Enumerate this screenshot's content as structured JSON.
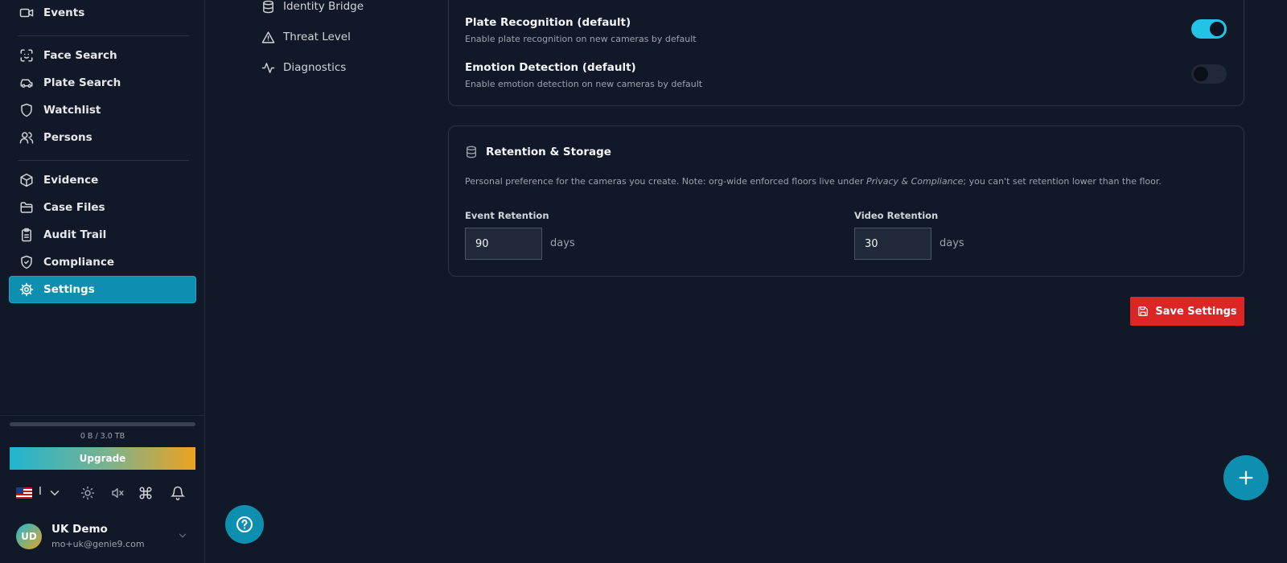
{
  "sidebar": {
    "items": [
      {
        "label": "Events",
        "icon": "video-icon"
      },
      {
        "label": "Face Search",
        "icon": "face-scan-icon"
      },
      {
        "label": "Plate Search",
        "icon": "car-icon"
      },
      {
        "label": "Watchlist",
        "icon": "shield-icon"
      },
      {
        "label": "Persons",
        "icon": "users-icon"
      },
      {
        "label": "Evidence",
        "icon": "package-icon"
      },
      {
        "label": "Case Files",
        "icon": "folder-icon"
      },
      {
        "label": "Audit Trail",
        "icon": "clipboard-icon"
      },
      {
        "label": "Compliance",
        "icon": "shield-check-icon"
      },
      {
        "label": "Settings",
        "icon": "gear-icon",
        "active": true
      }
    ],
    "storage": {
      "text": "0 B / 3.0 TB",
      "used_fraction": 0
    },
    "upgrade_label": "Upgrade",
    "language_text": "I",
    "user": {
      "initials": "UD",
      "name": "UK Demo",
      "email": "mo+uk@genie9.com"
    }
  },
  "settings_nav": [
    {
      "label": "Identity Bridge",
      "icon": "database-icon"
    },
    {
      "label": "Threat Level",
      "icon": "alert-triangle-icon"
    },
    {
      "label": "Diagnostics",
      "icon": "activity-icon"
    }
  ],
  "toggles": [
    {
      "title": "Plate Recognition (default)",
      "description": "Enable plate recognition on new cameras by default",
      "on": true
    },
    {
      "title": "Emotion Detection (default)",
      "description": "Enable emotion detection on new cameras by default",
      "on": false
    }
  ],
  "retention": {
    "title": "Retention & Storage",
    "desc_before": "Personal preference for the cameras you create. Note: org-wide enforced floors live under ",
    "desc_em": "Privacy & Compliance",
    "desc_after": "; you can't set retention lower than the floor.",
    "event_label": "Event Retention",
    "event_value": "90",
    "video_label": "Video Retention",
    "video_value": "30",
    "unit": "days"
  },
  "save_label": "Save Settings",
  "colors": {
    "accent": "#0e8fb0",
    "toggle_on": "#22c3e6",
    "danger": "#dc2626"
  }
}
